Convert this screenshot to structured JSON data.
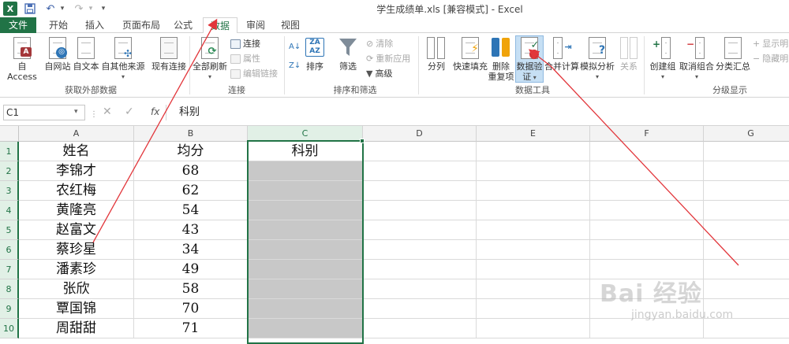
{
  "window": {
    "title": "学生成绩单.xls  [兼容模式] - Excel"
  },
  "quick_access": {
    "logo": "X",
    "save_icon": "save-icon",
    "undo_icon": "undo-icon",
    "redo_icon": "redo-icon"
  },
  "tabs": [
    {
      "label": "文件"
    },
    {
      "label": "开始"
    },
    {
      "label": "插入"
    },
    {
      "label": "页面布局"
    },
    {
      "label": "公式"
    },
    {
      "label": "数据"
    },
    {
      "label": "审阅"
    },
    {
      "label": "视图"
    }
  ],
  "ribbon": {
    "external": {
      "access": "自 Access",
      "web": "自网站",
      "text": "自文本",
      "other": "自其他来源",
      "existing": "现有连接",
      "group": "获取外部数据"
    },
    "connections": {
      "refresh_all": "全部刷新",
      "connections": "连接",
      "properties": "属性",
      "edit_links": "编辑链接",
      "group": "连接"
    },
    "sort_filter": {
      "sort": "排序",
      "filter": "筛选",
      "clear": "清除",
      "reapply": "重新应用",
      "advanced": "高级",
      "group": "排序和筛选"
    },
    "tools": {
      "split": "分列",
      "flash_fill": "快速填充",
      "remove_dup_1": "删除",
      "remove_dup_2": "重复项",
      "validation_1": "数据验",
      "validation_2": "证",
      "consolidate": "合并计算",
      "what_if": "模拟分析",
      "relations": "关系",
      "group": "数据工具"
    },
    "outline": {
      "group_btn": "创建组",
      "ungroup": "取消组合",
      "subtotal": "分类汇总",
      "show_detail": "显示明",
      "hide_detail": "隐藏明",
      "group": "分级显示"
    }
  },
  "formula_bar": {
    "name_box": "C1",
    "fx": "fx",
    "content": "科别"
  },
  "columns": [
    "A",
    "B",
    "C",
    "D",
    "E",
    "F",
    "G"
  ],
  "rows": [
    "1",
    "2",
    "3",
    "4",
    "5",
    "6",
    "7",
    "8",
    "9",
    "10"
  ],
  "table": {
    "headers": [
      "姓名",
      "均分",
      "科别"
    ],
    "names": [
      "李锦才",
      "农红梅",
      "黄隆亮",
      "赵富文",
      "蔡珍星",
      "潘素珍",
      "张欣",
      "覃国锦",
      "周甜甜"
    ],
    "scores": [
      "68",
      "62",
      "54",
      "43",
      "34",
      "49",
      "58",
      "70",
      "71"
    ]
  },
  "watermark": {
    "brand": "Bai 经验",
    "url": "jingyan.baidu.com"
  },
  "colors": {
    "accent": "#217346",
    "arrow": "#e2363b",
    "selection_fill": "#c8c8c8"
  }
}
